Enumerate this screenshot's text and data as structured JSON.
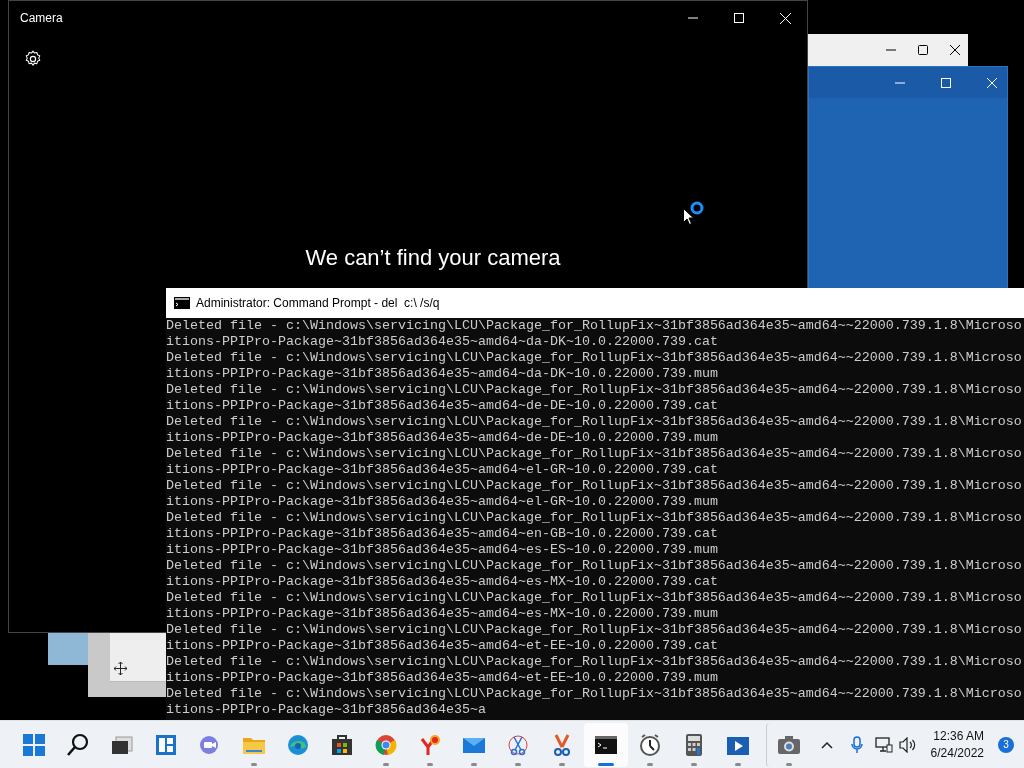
{
  "camera_window": {
    "title": "Camera",
    "message": "We can’t find your camera"
  },
  "console_window": {
    "title": "Administrator: Command Prompt - del  c:\\ /s/q",
    "lines": [
      "Deleted file - c:\\Windows\\servicing\\LCU\\Package_for_RollupFix~31bf3856ad364e35~amd64~~22000.739.1.8\\Microso",
      "itions-PPIPro-Package~31bf3856ad364e35~amd64~da-DK~10.0.22000.739.cat",
      "Deleted file - c:\\Windows\\servicing\\LCU\\Package_for_RollupFix~31bf3856ad364e35~amd64~~22000.739.1.8\\Microso",
      "itions-PPIPro-Package~31bf3856ad364e35~amd64~da-DK~10.0.22000.739.mum",
      "Deleted file - c:\\Windows\\servicing\\LCU\\Package_for_RollupFix~31bf3856ad364e35~amd64~~22000.739.1.8\\Microso",
      "itions-PPIPro-Package~31bf3856ad364e35~amd64~de-DE~10.0.22000.739.cat",
      "Deleted file - c:\\Windows\\servicing\\LCU\\Package_for_RollupFix~31bf3856ad364e35~amd64~~22000.739.1.8\\Microso",
      "itions-PPIPro-Package~31bf3856ad364e35~amd64~de-DE~10.0.22000.739.mum",
      "Deleted file - c:\\Windows\\servicing\\LCU\\Package_for_RollupFix~31bf3856ad364e35~amd64~~22000.739.1.8\\Microso",
      "itions-PPIPro-Package~31bf3856ad364e35~amd64~el-GR~10.0.22000.739.cat",
      "Deleted file - c:\\Windows\\servicing\\LCU\\Package_for_RollupFix~31bf3856ad364e35~amd64~~22000.739.1.8\\Microso",
      "itions-PPIPro-Package~31bf3856ad364e35~amd64~el-GR~10.0.22000.739.mum",
      "Deleted file - c:\\Windows\\servicing\\LCU\\Package_for_RollupFix~31bf3856ad364e35~amd64~~22000.739.1.8\\Microso",
      "itions-PPIPro-Package~31bf3856ad364e35~amd64~en-GB~10.0.22000.739.cat",
      "itions-PPIPro-Package~31bf3856ad364e35~amd64~es-ES~10.0.22000.739.mum",
      "Deleted file - c:\\Windows\\servicing\\LCU\\Package_for_RollupFix~31bf3856ad364e35~amd64~~22000.739.1.8\\Microso",
      "itions-PPIPro-Package~31bf3856ad364e35~amd64~es-MX~10.0.22000.739.cat",
      "Deleted file - c:\\Windows\\servicing\\LCU\\Package_for_RollupFix~31bf3856ad364e35~amd64~~22000.739.1.8\\Microso",
      "itions-PPIPro-Package~31bf3856ad364e35~amd64~es-MX~10.0.22000.739.mum",
      "Deleted file - c:\\Windows\\servicing\\LCU\\Package_for_RollupFix~31bf3856ad364e35~amd64~~22000.739.1.8\\Microso",
      "itions-PPIPro-Package~31bf3856ad364e35~amd64~et-EE~10.0.22000.739.cat",
      "Deleted file - c:\\Windows\\servicing\\LCU\\Package_for_RollupFix~31bf3856ad364e35~amd64~~22000.739.1.8\\Microso",
      "itions-PPIPro-Package~31bf3856ad364e35~amd64~et-EE~10.0.22000.739.mum",
      "Deleted file - c:\\Windows\\servicing\\LCU\\Package_for_RollupFix~31bf3856ad364e35~amd64~~22000.739.1.8\\Microso",
      "itions-PPIPro-Package~31bf3856ad364e35~a"
    ]
  },
  "taskbar": {
    "apps": [
      {
        "kind": "start",
        "running": false,
        "selected": false
      },
      {
        "kind": "search",
        "running": false,
        "selected": false
      },
      {
        "kind": "taskview",
        "running": false,
        "selected": false
      },
      {
        "kind": "widgets",
        "running": false,
        "selected": false
      },
      {
        "kind": "chat",
        "running": false,
        "selected": false
      },
      {
        "kind": "folder",
        "running": true,
        "selected": false
      },
      {
        "kind": "edge",
        "running": false,
        "selected": false
      },
      {
        "kind": "store",
        "running": false,
        "selected": false
      },
      {
        "kind": "chrome",
        "running": true,
        "selected": false
      },
      {
        "kind": "yandex",
        "running": true,
        "selected": false
      },
      {
        "kind": "mail",
        "running": true,
        "selected": false
      },
      {
        "kind": "snip",
        "running": true,
        "selected": false
      },
      {
        "kind": "paint",
        "running": true,
        "selected": false
      },
      {
        "kind": "terminal",
        "running": true,
        "selected": true
      },
      {
        "kind": "clock",
        "running": true,
        "selected": false
      },
      {
        "kind": "calculator",
        "running": true,
        "selected": false
      },
      {
        "kind": "media",
        "running": true,
        "selected": false
      },
      {
        "kind": "camera",
        "running": true,
        "selected": false
      }
    ],
    "time": "12:36 AM",
    "date": "6/24/2022",
    "notifications": "3"
  }
}
